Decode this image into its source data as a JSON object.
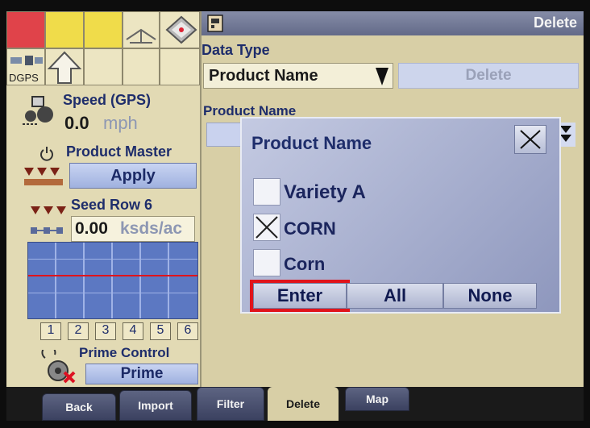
{
  "left": {
    "gps_label": "DGPS",
    "speed_title": "Speed (GPS)",
    "speed_value": "0.0",
    "speed_unit": "mph",
    "product_master_title": "Product Master",
    "apply_label": "Apply",
    "seed_row_title": "Seed Row 6",
    "seed_value": "0.00",
    "seed_unit": "ksds/ac",
    "row_numbers": [
      "1",
      "2",
      "3",
      "4",
      "5",
      "6"
    ],
    "prime_title": "Prime Control",
    "prime_label": "Prime"
  },
  "header": {
    "title": "Delete"
  },
  "form": {
    "data_type_label": "Data Type",
    "data_type_value": "Product Name",
    "delete_button": "Delete",
    "product_name_label": "Product Name"
  },
  "dialog": {
    "title": "Product Name",
    "options": [
      {
        "label": "Variety A",
        "checked": false
      },
      {
        "label": "CORN",
        "checked": true
      },
      {
        "label": "Corn",
        "checked": false
      }
    ],
    "enter_label": "Enter",
    "all_label": "All",
    "none_label": "None"
  },
  "tabs": [
    "Back",
    "Import",
    "Filter",
    "Delete",
    "Map"
  ],
  "colors": {
    "highlight": "#e0141b",
    "accent": "#1e2d6b"
  }
}
